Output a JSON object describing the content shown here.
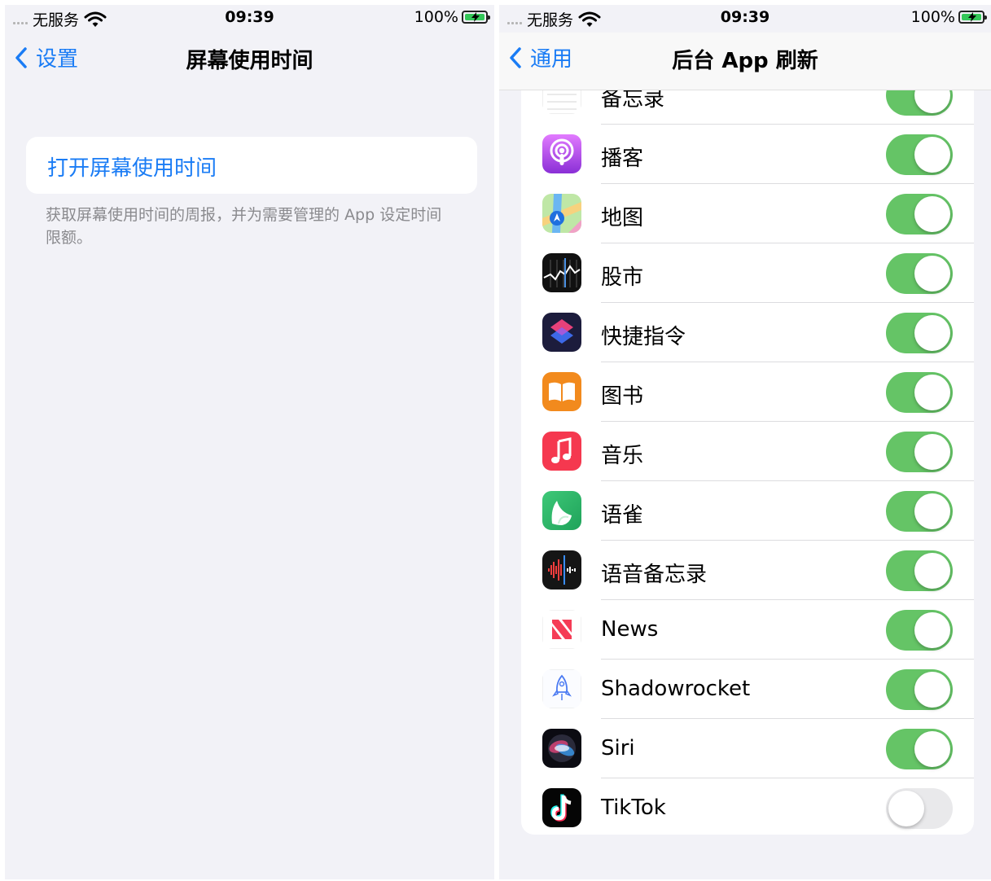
{
  "left": {
    "status": {
      "carrier": "无服务",
      "time": "09:39",
      "battery": "100%"
    },
    "nav": {
      "back_label": "设置",
      "title": "屏幕使用时间"
    },
    "turn_on_label": "打开屏幕使用时间",
    "footnote": "获取屏幕使用时间的周报，并为需要管理的 App 设定时间限额。"
  },
  "right": {
    "status": {
      "carrier": "无服务",
      "time": "09:39",
      "battery": "100%"
    },
    "nav": {
      "back_label": "通用",
      "title": "后台 App 刷新"
    },
    "apps": [
      {
        "name": "备忘录",
        "icon": "notes-icon",
        "enabled": true
      },
      {
        "name": "播客",
        "icon": "podcasts-icon",
        "enabled": true
      },
      {
        "name": "地图",
        "icon": "maps-icon",
        "enabled": true
      },
      {
        "name": "股市",
        "icon": "stocks-icon",
        "enabled": true
      },
      {
        "name": "快捷指令",
        "icon": "shortcuts-icon",
        "enabled": true
      },
      {
        "name": "图书",
        "icon": "books-icon",
        "enabled": true
      },
      {
        "name": "音乐",
        "icon": "music-icon",
        "enabled": true
      },
      {
        "name": "语雀",
        "icon": "yuque-icon",
        "enabled": true
      },
      {
        "name": "语音备忘录",
        "icon": "voice-memos-icon",
        "enabled": true
      },
      {
        "name": "News",
        "icon": "news-icon",
        "enabled": true
      },
      {
        "name": "Shadowrocket",
        "icon": "shadowrocket-icon",
        "enabled": true
      },
      {
        "name": "Siri",
        "icon": "siri-icon",
        "enabled": true
      },
      {
        "name": "TikTok",
        "icon": "tiktok-icon",
        "enabled": false
      }
    ]
  },
  "colors": {
    "accent": "#1a7cf5",
    "toggle_on": "#65c466",
    "toggle_off": "#e9e9eb",
    "background": "#f2f2f7"
  }
}
